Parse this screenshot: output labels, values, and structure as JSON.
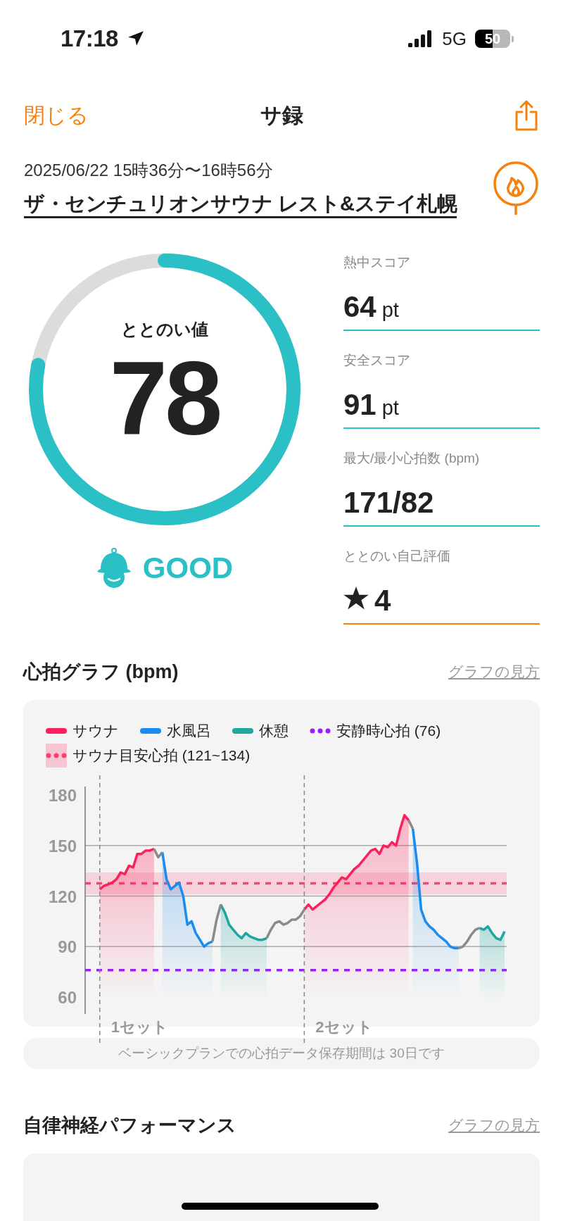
{
  "status_bar": {
    "time": "17:18",
    "network": "5G",
    "battery": "50"
  },
  "nav": {
    "close": "閉じる",
    "title": "サ録"
  },
  "session": {
    "datetime": "2025/06/22 15時36分〜16時56分",
    "venue": "ザ・センチュリオンサウナ レスト&ステイ札幌"
  },
  "score": {
    "label": "ととのい値",
    "value": "78",
    "level": 0.78,
    "grade": "GOOD"
  },
  "stats": [
    {
      "kind": "score",
      "label": "熱中スコア",
      "value": "64",
      "unit": "pt"
    },
    {
      "kind": "score",
      "label": "安全スコア",
      "value": "91",
      "unit": "pt"
    },
    {
      "kind": "plain",
      "label": "最大/最小心拍数 (bpm)",
      "value": "171/82"
    },
    {
      "kind": "rating",
      "label": "ととのい自己評価",
      "value": "4"
    }
  ],
  "heart_section": {
    "title": "心拍グラフ (bpm)",
    "link": "グラフの見方",
    "chart_data": {
      "type": "line",
      "ylim": [
        50,
        185
      ],
      "yticks": [
        60,
        90,
        120,
        150,
        180
      ],
      "grid": true,
      "series": [
        {
          "name": "サウナ",
          "color": "#ff1f5a",
          "values": [
            null,
            null,
            null,
            124,
            126,
            127,
            128,
            130,
            134,
            133,
            138,
            137,
            145,
            145,
            147,
            147,
            148,
            null,
            null,
            null,
            null,
            null,
            null,
            null,
            null,
            null,
            null,
            null,
            null,
            null,
            null,
            null,
            null,
            null,
            null,
            null,
            null,
            null,
            null,
            null,
            null,
            null,
            null,
            null,
            null,
            null,
            null,
            null,
            null,
            null,
            null,
            null,
            112,
            115,
            112,
            114,
            116,
            118,
            121,
            125,
            128,
            131,
            130,
            133,
            136,
            138,
            141,
            144,
            147,
            148,
            145,
            150,
            149,
            152,
            150,
            160,
            168,
            165,
            null,
            null,
            null,
            null,
            null,
            null,
            null,
            null,
            null,
            null,
            null,
            null,
            null,
            null,
            null,
            null,
            null,
            null,
            null,
            null,
            null,
            null,
            null
          ]
        },
        {
          "name": "水風呂",
          "color": "#1a8cf0",
          "values": [
            null,
            null,
            null,
            null,
            null,
            null,
            null,
            null,
            null,
            null,
            null,
            null,
            null,
            null,
            null,
            null,
            null,
            null,
            146,
            130,
            124,
            126,
            128,
            120,
            103,
            105,
            98,
            94,
            90,
            92,
            93,
            null,
            null,
            null,
            null,
            null,
            null,
            null,
            null,
            null,
            null,
            null,
            null,
            null,
            null,
            null,
            null,
            null,
            null,
            null,
            null,
            null,
            null,
            null,
            null,
            null,
            null,
            null,
            null,
            null,
            null,
            null,
            null,
            null,
            null,
            null,
            null,
            null,
            null,
            null,
            null,
            null,
            null,
            null,
            null,
            null,
            null,
            null,
            160,
            140,
            112,
            105,
            102,
            100,
            97,
            95,
            93,
            90,
            89,
            89,
            null,
            null,
            null,
            null,
            null,
            null,
            null,
            null,
            null,
            null,
            null
          ]
        },
        {
          "name": "休憩",
          "color": "#1fa6a0",
          "values": [
            null,
            null,
            null,
            null,
            null,
            null,
            null,
            null,
            null,
            null,
            null,
            null,
            null,
            null,
            null,
            null,
            null,
            null,
            null,
            null,
            null,
            null,
            null,
            null,
            null,
            null,
            null,
            null,
            null,
            null,
            null,
            null,
            115,
            110,
            103,
            100,
            97,
            95,
            98,
            96,
            95,
            94,
            94,
            95,
            null,
            null,
            null,
            null,
            null,
            null,
            null,
            null,
            null,
            null,
            null,
            null,
            null,
            null,
            null,
            null,
            null,
            null,
            null,
            null,
            null,
            null,
            null,
            null,
            null,
            null,
            null,
            null,
            null,
            null,
            null,
            null,
            null,
            null,
            null,
            null,
            null,
            null,
            null,
            null,
            null,
            null,
            null,
            null,
            null,
            null,
            null,
            null,
            null,
            null,
            101,
            100,
            102,
            98,
            95,
            94,
            99
          ]
        },
        {
          "color": "#8a8a8a",
          "values": [
            null,
            null,
            null,
            null,
            null,
            null,
            null,
            null,
            null,
            null,
            null,
            null,
            null,
            null,
            null,
            null,
            148,
            143,
            146,
            null,
            null,
            null,
            null,
            null,
            null,
            null,
            null,
            null,
            null,
            null,
            93,
            106,
            115,
            null,
            null,
            null,
            null,
            null,
            null,
            null,
            null,
            null,
            null,
            95,
            100,
            104,
            105,
            103,
            104,
            106,
            106,
            108,
            112,
            null,
            null,
            null,
            null,
            null,
            null,
            null,
            null,
            null,
            null,
            null,
            null,
            null,
            null,
            null,
            null,
            null,
            null,
            null,
            null,
            null,
            null,
            null,
            null,
            165,
            160,
            null,
            null,
            null,
            null,
            null,
            null,
            null,
            null,
            null,
            null,
            89,
            90,
            93,
            97,
            100,
            101,
            null,
            null,
            null,
            null,
            null,
            null
          ]
        }
      ],
      "ref_lines": [
        {
          "axis": "y",
          "value": 76,
          "label": "安静時心拍 (76)",
          "color": "#9b1cff"
        },
        {
          "axis": "y",
          "value": 127.5,
          "color": "#ff3d6e"
        }
      ],
      "bands": [
        {
          "axis": "y",
          "from": 121,
          "to": 134,
          "label": "サウナ目安心拍 (121~134)",
          "color": "#ff3d6e"
        }
      ],
      "annotations": [
        "1セット",
        "2セット"
      ]
    },
    "notice": "ベーシックプランでの心拍データ保存期間は 30日です"
  },
  "autonomic_section": {
    "title": "自律神経パフォーマンス",
    "link": "グラフの見方"
  }
}
